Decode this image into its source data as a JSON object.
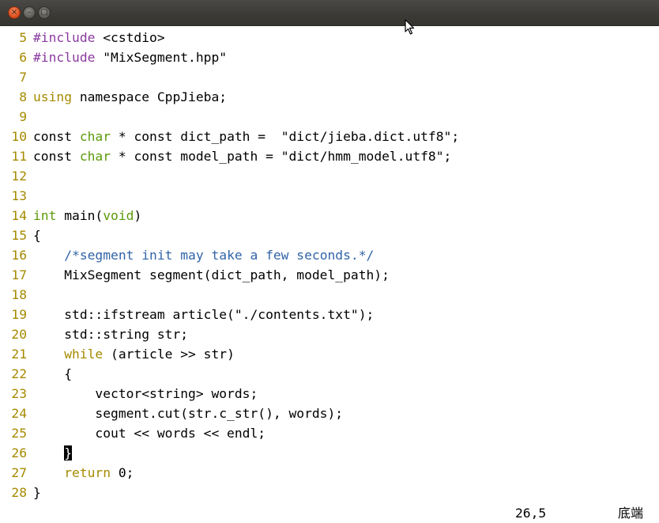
{
  "window": {
    "close_icon": "close-icon",
    "minimize_icon": "minimize-icon",
    "maximize_icon": "maximize-icon"
  },
  "colors": {
    "titlebar": "#3c3b37",
    "line_number": "#a58a00",
    "preproc": "#8a3aa0",
    "type": "#5c9a0a",
    "statement": "#a58a00",
    "comment": "#3264a8"
  },
  "lines": [
    {
      "n": "5",
      "parts": [
        {
          "t": "#include",
          "c": "kw-inc"
        },
        {
          "t": " <cstdio>",
          "c": ""
        }
      ]
    },
    {
      "n": "6",
      "parts": [
        {
          "t": "#include",
          "c": "kw-inc"
        },
        {
          "t": " \"MixSegment.hpp\"",
          "c": ""
        }
      ]
    },
    {
      "n": "7",
      "parts": []
    },
    {
      "n": "8",
      "parts": [
        {
          "t": "using",
          "c": "kw-stmt"
        },
        {
          "t": " namespace CppJieba;",
          "c": ""
        }
      ]
    },
    {
      "n": "9",
      "parts": []
    },
    {
      "n": "10",
      "parts": [
        {
          "t": "const ",
          "c": ""
        },
        {
          "t": "char",
          "c": "kw-type"
        },
        {
          "t": " * const dict_path =  \"dict/jieba.dict.utf8\";",
          "c": ""
        }
      ]
    },
    {
      "n": "11",
      "parts": [
        {
          "t": "const ",
          "c": ""
        },
        {
          "t": "char",
          "c": "kw-type"
        },
        {
          "t": " * const model_path = \"dict/hmm_model.utf8\";",
          "c": ""
        }
      ]
    },
    {
      "n": "12",
      "parts": []
    },
    {
      "n": "13",
      "parts": []
    },
    {
      "n": "14",
      "parts": [
        {
          "t": "int",
          "c": "kw-type"
        },
        {
          "t": " main(",
          "c": ""
        },
        {
          "t": "void",
          "c": "kw-type"
        },
        {
          "t": ")",
          "c": ""
        }
      ]
    },
    {
      "n": "15",
      "parts": [
        {
          "t": "{",
          "c": ""
        }
      ]
    },
    {
      "n": "16",
      "parts": [
        {
          "t": "    ",
          "c": ""
        },
        {
          "t": "/*segment init may take a few seconds.*/",
          "c": "cmt"
        }
      ]
    },
    {
      "n": "17",
      "parts": [
        {
          "t": "    MixSegment segment(dict_path, model_path);",
          "c": ""
        }
      ]
    },
    {
      "n": "18",
      "parts": []
    },
    {
      "n": "19",
      "parts": [
        {
          "t": "    std::ifstream article(\"./contents.txt\");",
          "c": ""
        }
      ]
    },
    {
      "n": "20",
      "parts": [
        {
          "t": "    std::string str;",
          "c": ""
        }
      ]
    },
    {
      "n": "21",
      "parts": [
        {
          "t": "    ",
          "c": ""
        },
        {
          "t": "while",
          "c": "kw-stmt"
        },
        {
          "t": " (article >> str)",
          "c": ""
        }
      ]
    },
    {
      "n": "22",
      "parts": [
        {
          "t": "    {",
          "c": ""
        }
      ]
    },
    {
      "n": "23",
      "parts": [
        {
          "t": "        vector<string> words;",
          "c": ""
        }
      ]
    },
    {
      "n": "24",
      "parts": [
        {
          "t": "        segment.cut(str.c_str(), words);",
          "c": ""
        }
      ]
    },
    {
      "n": "25",
      "parts": [
        {
          "t": "        cout << words << endl;",
          "c": ""
        }
      ]
    },
    {
      "n": "26",
      "parts": [
        {
          "t": "    ",
          "c": ""
        },
        {
          "t": "}",
          "c": "cur"
        }
      ]
    },
    {
      "n": "27",
      "parts": [
        {
          "t": "    ",
          "c": ""
        },
        {
          "t": "return",
          "c": "kw-stmt"
        },
        {
          "t": " 0;",
          "c": ""
        }
      ]
    },
    {
      "n": "28",
      "parts": [
        {
          "t": "}",
          "c": ""
        }
      ]
    }
  ],
  "status": {
    "position": "26,5",
    "scroll": "底端"
  }
}
